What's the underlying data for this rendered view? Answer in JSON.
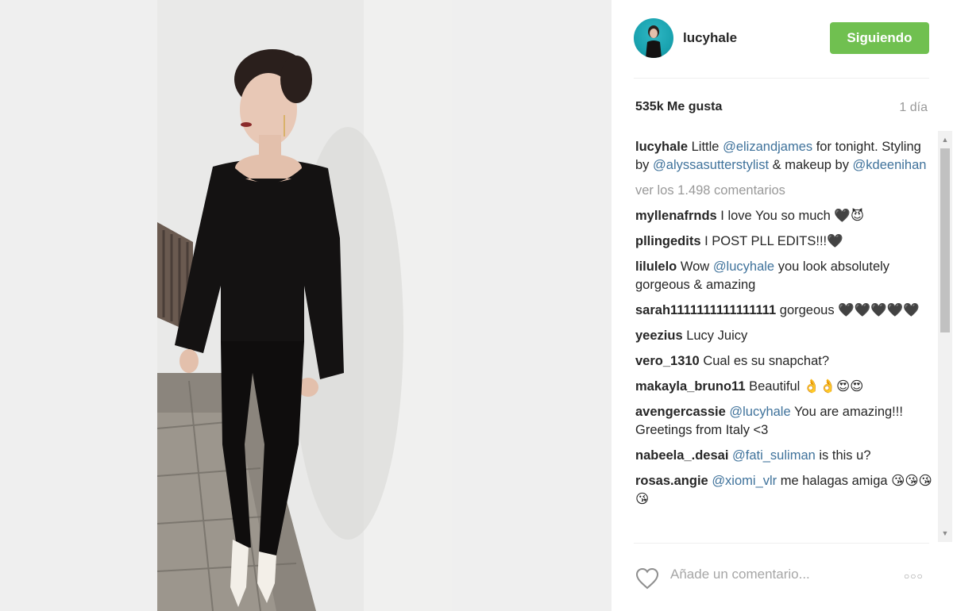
{
  "post": {
    "username": "lucyhale",
    "follow_label": "Siguiendo",
    "likes": "535k Me gusta",
    "time": "1 día"
  },
  "caption": {
    "user": "lucyhale",
    "t1": " Little ",
    "m1": "@elizandjames",
    "t2": " for tonight. Styling by ",
    "m2": "@alyssasutterstylist",
    "t3": " & makeup by ",
    "m3": "@kdeenihan"
  },
  "view_comments": "ver los 1.498 comentarios",
  "comments": [
    {
      "user": "myllenafrnds",
      "text": " I love You so much 🖤😈"
    },
    {
      "user": "pllingedits",
      "text": " I POST PLL EDITS!!!🖤"
    },
    {
      "user": "lilulelo",
      "pre": " Wow ",
      "mention": "@lucyhale",
      "text": " you look absolutely gorgeous & amazing"
    },
    {
      "user": "sarah1111111111111111",
      "text": " gorgeous 🖤🖤🖤🖤🖤"
    },
    {
      "user": "yeezius",
      "text": " Lucy Juicy"
    },
    {
      "user": "vero_1310",
      "text": " Cual es su snapchat?"
    },
    {
      "user": "makayla_bruno11",
      "text": " Beautiful 👌👌😍😍"
    },
    {
      "user": "avengercassie",
      "pre": " ",
      "mention": "@lucyhale",
      "text": " You are amazing!!! Greetings from Italy <3"
    },
    {
      "user": "nabeela_.desai",
      "pre": " ",
      "mention": "@fati_suliman",
      "text": " is this u?"
    },
    {
      "user": "rosas.angie",
      "pre": " ",
      "mention": "@xiomi_vlr",
      "text": " me halagas amiga 😘😘😘😘"
    }
  ],
  "input": {
    "placeholder": "Añade un comentario...",
    "more_label": "○○○"
  },
  "icons": {
    "like": "heart-icon",
    "options": "more-options-icon",
    "scroll_up": "scroll-up-arrow",
    "scroll_down": "scroll-down-arrow"
  },
  "colors": {
    "follow_button": "#70c050",
    "mention": "#3f729b",
    "muted_text": "#999999"
  }
}
